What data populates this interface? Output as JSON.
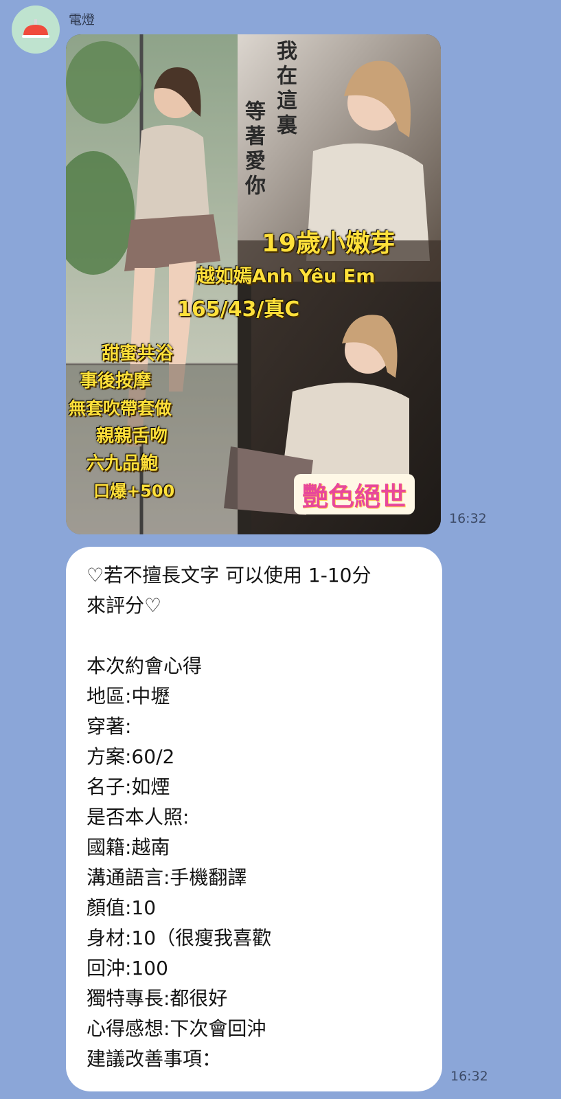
{
  "chat": {
    "sender": {
      "name": "電燈",
      "avatar_icon": "red-lamp-icon",
      "avatar_bg": "#bfe3cf"
    },
    "messages": [
      {
        "type": "image",
        "time": "16:32",
        "poster": {
          "vertical_text_1": "我在這裏",
          "vertical_text_2": "等著愛你",
          "age_tag": "19歲小嫩芽",
          "name_tag": "越如嫣Anh Yêu Em",
          "stats_tag": "165/43/真C",
          "services": [
            "甜蜜共浴",
            "事後按摩",
            "無套吹帶套做",
            "親親舌吻",
            "六九品鮑",
            "口爆+500"
          ],
          "badge": "艷色絕世"
        }
      },
      {
        "type": "text",
        "time": "16:32",
        "lines": [
          "♡若不擅長文字 可以使用 1-10分",
          "來評分♡",
          "",
          "本次約會心得",
          "地區:中壢",
          "穿著:",
          "方案:60/2",
          "名子:如煙",
          "是否本人照:",
          "國籍:越南",
          "溝通語言:手機翻譯",
          "顏值:10",
          "身材:10（很瘦我喜歡",
          "回沖:100",
          "獨特專長:都很好",
          "心得感想:下次會回沖",
          "建議改善事項："
        ]
      }
    ]
  },
  "colors": {
    "background": "#8ba6d8",
    "bubble": "#ffffff",
    "badge_pink": "#e8489a",
    "poster_yellow": "#ffe03a"
  }
}
